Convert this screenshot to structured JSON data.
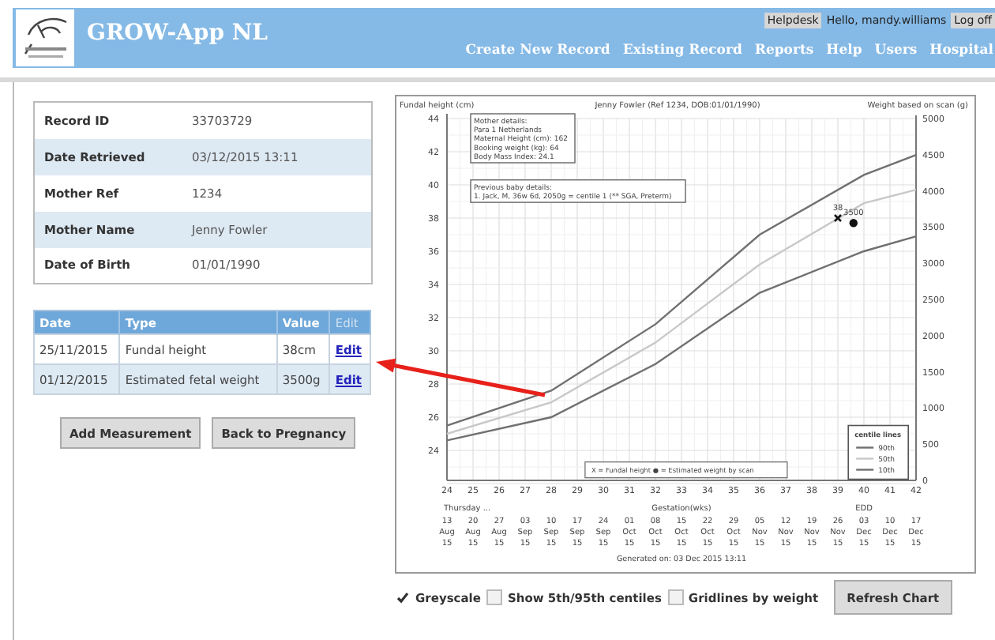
{
  "header": {
    "app_title": "GROW-App NL",
    "helpdesk": "Helpdesk",
    "greeting": "Hello, mandy.williams",
    "logout": "Log off",
    "nav": [
      "Create New Record",
      "Existing Record",
      "Reports",
      "Help",
      "Users",
      "Hospital"
    ]
  },
  "record": [
    {
      "label": "Record ID",
      "value": "33703729"
    },
    {
      "label": "Date Retrieved",
      "value": "03/12/2015 13:11"
    },
    {
      "label": "Mother Ref",
      "value": "1234"
    },
    {
      "label": "Mother Name",
      "value": "Jenny Fowler"
    },
    {
      "label": "Date of Birth",
      "value": "01/01/1990"
    }
  ],
  "measurements": {
    "columns": [
      "Date",
      "Type",
      "Value",
      "Edit"
    ],
    "rows": [
      {
        "date": "25/11/2015",
        "type": "Fundal height",
        "value": "38cm",
        "action": "Edit"
      },
      {
        "date": "01/12/2015",
        "type": "Estimated fetal weight",
        "value": "3500g",
        "action": "Edit"
      }
    ]
  },
  "buttons": [
    "Add Measurement",
    "Back to Pregnancy"
  ],
  "chart": {
    "weight_axis": {
      "label": "Weight based on scan (g)",
      "ticks": [
        "5000",
        "4500",
        "4000",
        "3500",
        "3000",
        "2500",
        "2000",
        "1500",
        "1000",
        "500",
        "0"
      ]
    },
    "mother_details": [
      "Mother details:",
      "Para 1 Netherlands",
      "Maternal Height (cm): 162",
      "Booking weight (kg): 64",
      "Body Mass Index: 24.1"
    ],
    "previous_baby": [
      "Previous baby details:",
      "1. Jack, M, 36w 6d, 2050g = centile 1 (** SGA, Preterm)"
    ],
    "key": "X = Fundal height   ● = Estimated weight by scan",
    "start_day": "Thursday ...",
    "edd": "EDD",
    "dates": [
      {
        "day": "13",
        "month": "Aug",
        "year": "15"
      },
      {
        "day": "20",
        "month": "Aug",
        "year": "15"
      },
      {
        "day": "27",
        "month": "Aug",
        "year": "15"
      },
      {
        "day": "03",
        "month": "Sep",
        "year": "15"
      },
      {
        "day": "10",
        "month": "Sep",
        "year": "15"
      },
      {
        "day": "17",
        "month": "Sep",
        "year": "15"
      },
      {
        "day": "24",
        "month": "Sep",
        "year": "15"
      },
      {
        "day": "01",
        "month": "Oct",
        "year": "15"
      },
      {
        "day": "08",
        "month": "Oct",
        "year": "15"
      },
      {
        "day": "15",
        "month": "Oct",
        "year": "15"
      },
      {
        "day": "22",
        "month": "Oct",
        "year": "15"
      },
      {
        "day": "29",
        "month": "Oct",
        "year": "15"
      },
      {
        "day": "05",
        "month": "Nov",
        "year": "15"
      },
      {
        "day": "12",
        "month": "Nov",
        "year": "15"
      },
      {
        "day": "19",
        "month": "Nov",
        "year": "15"
      },
      {
        "day": "26",
        "month": "Nov",
        "year": "15"
      },
      {
        "day": "03",
        "month": "Dec",
        "year": "15"
      },
      {
        "day": "10",
        "month": "Dec",
        "year": "15"
      },
      {
        "day": "17",
        "month": "Dec",
        "year": "15"
      }
    ],
    "generated": "Generated on: 03 Dec 2015 13:11",
    "chart_data": {
      "type": "line",
      "title": "Jenny Fowler (Ref 1234, DOB:01/01/1990)",
      "xlabel": "Gestation(wks)",
      "ylabel": "Fundal height (cm)",
      "x": [
        24,
        28,
        32,
        36,
        40,
        42
      ],
      "series": [
        {
          "name": "90th",
          "color": "#707070",
          "values": [
            25.5,
            27.6,
            31.6,
            37.0,
            40.6,
            41.8
          ]
        },
        {
          "name": "50th",
          "color": "#c8c8c8",
          "values": [
            25.0,
            26.9,
            30.5,
            35.2,
            38.9,
            39.7
          ]
        },
        {
          "name": "10th",
          "color": "#707070",
          "values": [
            24.6,
            26.0,
            29.2,
            33.5,
            36.0,
            36.9
          ]
        }
      ],
      "xlim": [
        24,
        42
      ],
      "ylim": [
        22,
        44
      ],
      "xticks": [
        24,
        25,
        26,
        27,
        28,
        29,
        30,
        31,
        32,
        33,
        34,
        35,
        36,
        37,
        38,
        39,
        40,
        41,
        42
      ],
      "yticks": [
        24,
        26,
        28,
        30,
        32,
        34,
        36,
        38,
        40,
        42,
        44
      ],
      "grid": true,
      "legend": {
        "title": "centile lines"
      },
      "annotations": [
        {
          "text": "38",
          "x": 39,
          "y": 38
        },
        {
          "text": "3500",
          "x": 39.6,
          "y": 37.7
        }
      ]
    }
  },
  "controls": {
    "options": [
      {
        "label": "Greyscale",
        "checked": true
      },
      {
        "label": "Show 5th/95th centiles",
        "checked": false
      },
      {
        "label": "Gridlines by weight",
        "checked": false
      }
    ],
    "button": "Refresh Chart"
  }
}
